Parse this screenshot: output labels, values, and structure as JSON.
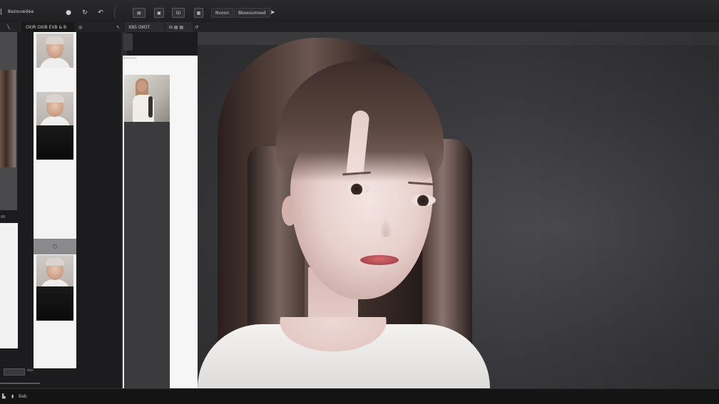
{
  "toolbar": {
    "title": "Bezouwdee",
    "menu_glyph": "|",
    "buttons": {
      "record_icon": "●",
      "refresh_icon": "↻",
      "undo_icon": "↶",
      "box1": "▤",
      "box2": "▣",
      "box3": "GI",
      "box4": "▦"
    },
    "pill_left": "Nvoon",
    "pill_right": "Bkoxoumoed",
    "pin_icon": "➤"
  },
  "subbar": {
    "left_arrow": "╲",
    "seg1": "OXIR OXIB EVB & B",
    "seg1_icon": "◎",
    "seg2_left": "↖",
    "seg2": "XBS OXOT",
    "seg3": "⊟ ▤ ▤",
    "seg3_icon": "↺"
  },
  "left_panel": {
    "mini_label": "88",
    "bottom_label": "mu"
  },
  "statusbar": {
    "icon1": "▙",
    "icon2": "▮",
    "label": "Bab"
  },
  "colors": {
    "canvas": "#3a3a3e",
    "panel_light": "#f4f4f4",
    "toolbar": "#232325",
    "lips": "#c05a60"
  }
}
